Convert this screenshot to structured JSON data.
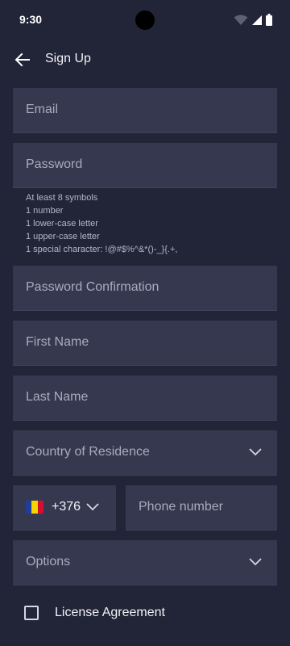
{
  "status_bar": {
    "time": "9:30",
    "icons": [
      "wifi-icon",
      "signal-icon",
      "battery-icon"
    ]
  },
  "header": {
    "back_icon": "arrow-left-icon",
    "title": "Sign Up"
  },
  "form": {
    "email_placeholder": "Email",
    "password_placeholder": "Password",
    "password_hint": [
      "At least 8 symbols",
      "1 number",
      "1 lower-case letter",
      "1 upper-case letter",
      "1 special character: !@#$%^&*()-_}{.+,"
    ],
    "password_confirmation_placeholder": "Password Confirmation",
    "first_name_placeholder": "First Name",
    "last_name_placeholder": "Last Name",
    "country_placeholder": "Country of Residence",
    "phone_code": "+376",
    "phone_code_flag": "andorra-flag-icon",
    "phone_number_placeholder": "Phone number",
    "options_placeholder": "Options",
    "license_label": "License Agreement",
    "license_checked": false
  },
  "colors": {
    "background": "#222437",
    "field_background": "#363850",
    "placeholder_text": "#a9abbd",
    "text": "#f2f2f6"
  }
}
